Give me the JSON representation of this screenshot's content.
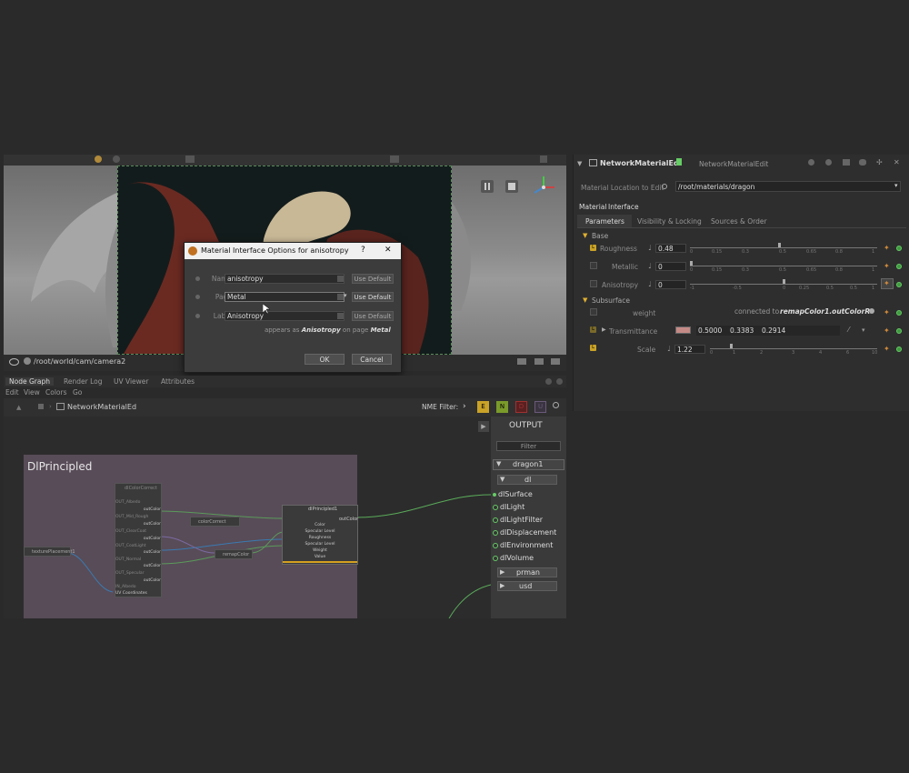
{
  "viewer": {
    "camera_path": "/root/world/cam/camera2"
  },
  "dialog": {
    "title": "Material Interface Options for anisotropy",
    "help": "?",
    "close": "✕",
    "name_label": "Name",
    "name_value": "anisotropy",
    "page_label": "Page",
    "page_value": "Metal",
    "label_label": "Label",
    "label_value": "Anisotropy",
    "use_default": "Use Default",
    "appears_as": "appears as",
    "appears_label": "Anisotropy",
    "on_page": "on page",
    "appears_page": "Metal",
    "ok": "OK",
    "cancel": "Cancel"
  },
  "node_graph": {
    "tabs": [
      "Node Graph",
      "Render Log",
      "UV Viewer",
      "Attributes"
    ],
    "menu": [
      "Edit",
      "View",
      "Colors",
      "Go"
    ],
    "breadcrumb": "NetworkMaterialEd",
    "nme_filter": "NME Filter:",
    "filter_buttons": [
      "E",
      "N",
      "D",
      "U"
    ],
    "backdrop_title": "DlPrincipled",
    "principled_node": {
      "title": "dlPrincipled1",
      "out": "outColor",
      "inputs": [
        "Color",
        "Specular Level",
        "Roughness",
        "Specular Level",
        "Weight",
        "Value"
      ]
    },
    "left_node": {
      "title": "dlColorCorrect",
      "rows": [
        "OUT_Albedo",
        "outColor",
        "OUT_Mid_Rough",
        "outColor",
        "OUT_ClearCoat",
        "outColor",
        "OUT_CoatLight",
        "outColor",
        "OUT_Normal",
        "outColor",
        "OUT_Specular",
        "outColor",
        "IN_Albedo",
        "UV Coordinates"
      ]
    },
    "small_nodes": [
      "texturePlacement1",
      "colorCorrect",
      "remapColor"
    ],
    "output": {
      "title": "OUTPUT",
      "filter": "Filter",
      "dragon": "dragon1",
      "dl": "dl",
      "ports": [
        "dlSurface",
        "dlLight",
        "dlLightFilter",
        "dlDisplacement",
        "dlEnvironment",
        "dlVolume"
      ],
      "prman": "prman",
      "usd": "usd"
    }
  },
  "rpanel": {
    "node_name": "NetworkMaterialEd",
    "node_type": "NetworkMaterialEdit",
    "location_label": "Material Location to Edit",
    "location_value": "/root/materials/dragon",
    "section_tabs": [
      "Material",
      "Interface"
    ],
    "tabs": [
      "Parameters",
      "Visibility & Locking",
      "Sources & Order"
    ],
    "base_group": "Base",
    "roughness_label": "Roughness",
    "roughness_value": "0.48",
    "metallic_label": "Metallic",
    "metallic_value": "0",
    "anisotropy_label": "Anisotropy",
    "anisotropy_value": "0",
    "slider_ticks_a": [
      "0",
      "0.15",
      "0.3",
      "0.5",
      "0.65",
      "0.8",
      "1"
    ],
    "slider_ticks_b": [
      "-1",
      "-0.5",
      "0",
      "0.25",
      "0.5",
      "0.5",
      "1"
    ],
    "subsurface_group": "Subsurface",
    "weight_label": "weight",
    "connected_to": "connected to",
    "connected_value": "remapColor1.outColorR",
    "transmittance_label": "Transmittance",
    "transmittance_values": [
      "0.5000",
      "0.3383",
      "0.2914"
    ],
    "transmittance_color": "#c48a86",
    "scale_label": "Scale",
    "scale_value": "1.22",
    "slider_ticks_c": [
      "0",
      "1",
      "2",
      "3",
      "4",
      "6",
      "10"
    ]
  },
  "colors": {
    "accent_green": "#6c6",
    "lock_yellow": "#c9a227",
    "filter_E": "#c9a227",
    "filter_N": "#7a9a2a",
    "filter_D": "#a03030",
    "filter_U": "#6a5a7a"
  }
}
